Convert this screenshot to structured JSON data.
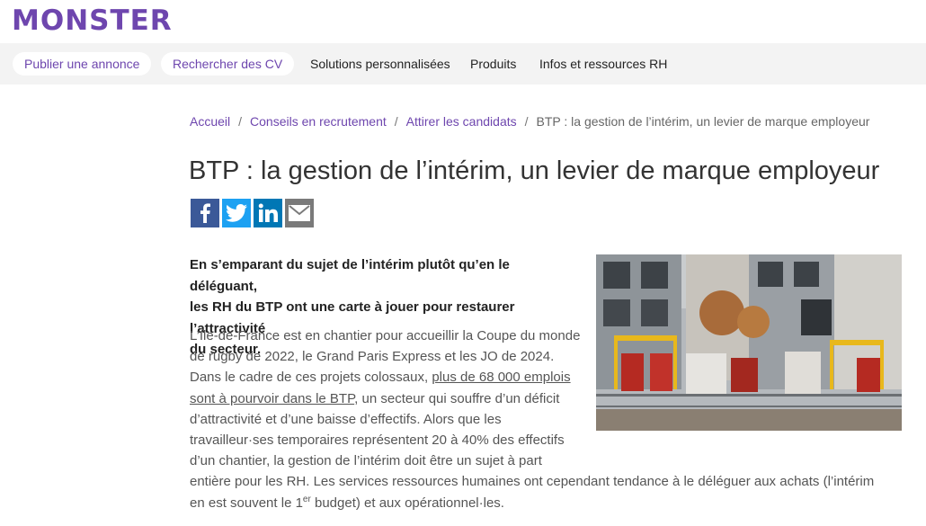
{
  "brand": {
    "logo_text": "MONSTER",
    "color": "#6e46ae"
  },
  "nav": {
    "publish": "Publier une annonce",
    "search_cv": "Rechercher des CV",
    "solutions": "Solutions personnalisées",
    "products": "Produits",
    "resources": "Infos et ressources RH"
  },
  "breadcrumb": {
    "home": "Accueil",
    "advice": "Conseils en recrutement",
    "attract": "Attirer les candidats",
    "current": "BTP : la gestion de l’intérim, un levier de marque employeur",
    "separator": "/"
  },
  "article": {
    "title": "BTP : la gestion de l’intérim, un levier de marque employeur",
    "share_icons": [
      "facebook-icon",
      "twitter-icon",
      "linkedin-icon",
      "email-icon"
    ],
    "lead_lines": [
      "En s’emparant du sujet de l’intérim plutôt qu’en le déléguant,",
      "les RH du BTP ont une carte à jouer pour restaurer l’attractivité",
      "du secteur."
    ],
    "body": {
      "l1": "L’Île-de-France est en chantier pour accueillir la Coupe du monde",
      "l2": "de rugby de 2022, le Grand Paris Express et les JO de 2024.",
      "l3_pre": "Dans le cadre de ces projets colossaux, ",
      "link_a": "plus de 68 000 emplois",
      "link_b": "sont à pourvoir dans le BTP",
      "l4_post": ", un secteur qui souffre d’un déficit",
      "l5": "d’attractivité et d’une baisse d’effectifs. Alors que les",
      "l6": "travailleur·ses temporaires représentent 20 à 40% des effectifs",
      "l7": "d’un chantier, la gestion de l’intérim doit être un sujet à part",
      "l8": "entière pour les RH. Les services ressources humaines ont cependant tendance à le déléguer aux achats (l’intérim",
      "l9_pre": "en est souvent le 1",
      "l9_sup": "er",
      "l9_post": " budget) et aux opérationnel·les."
    }
  }
}
